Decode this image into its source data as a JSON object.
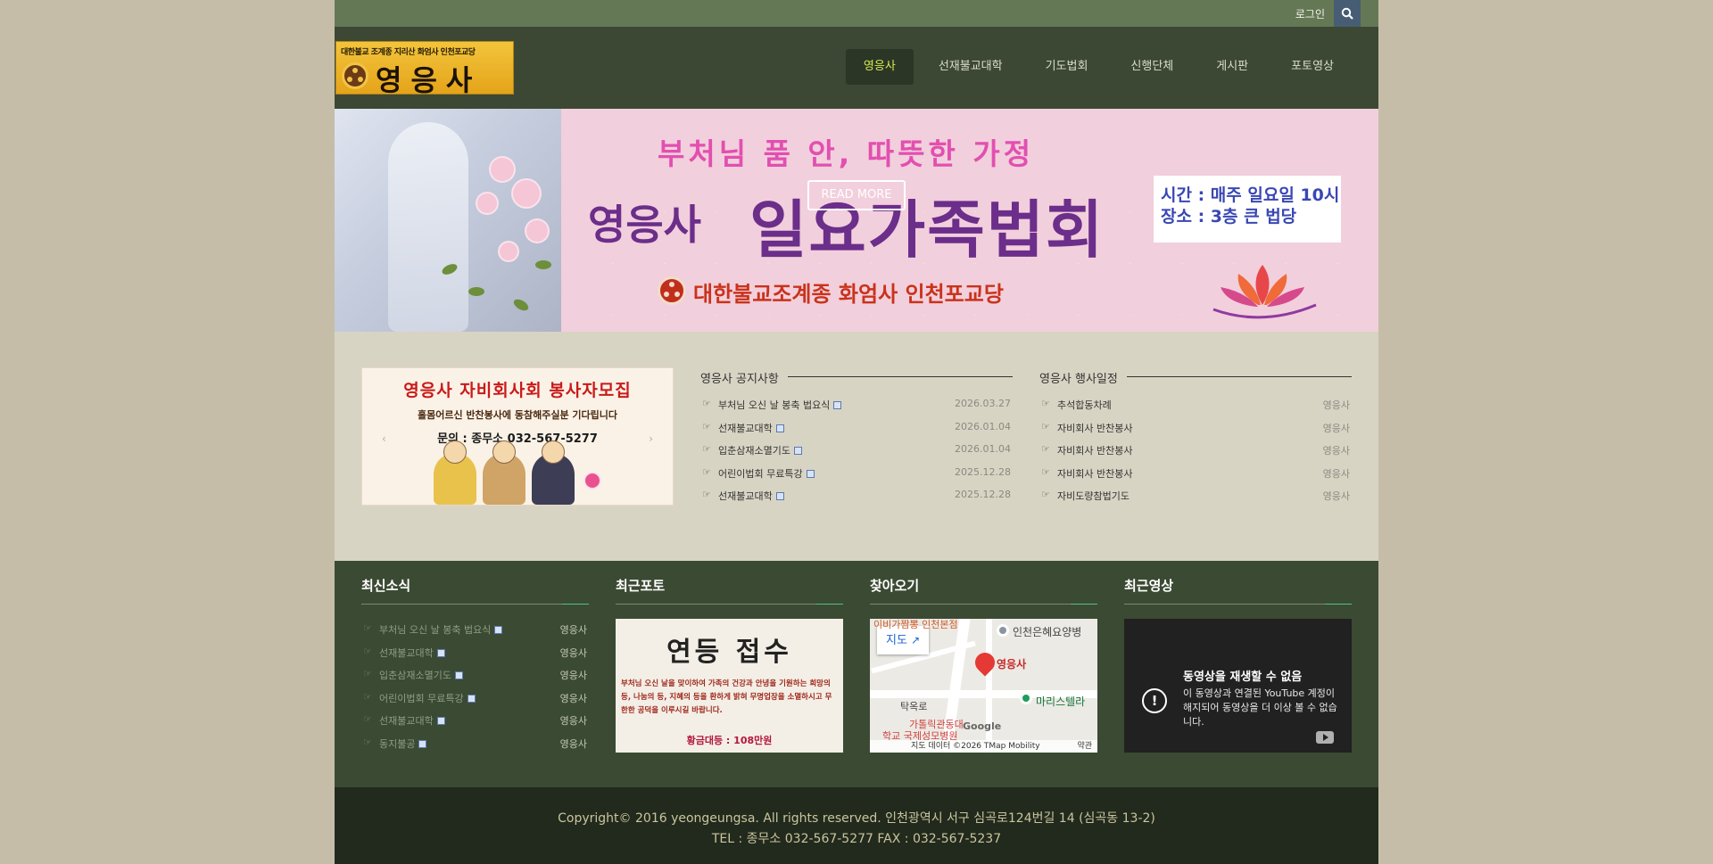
{
  "topbar": {
    "login": "로그인",
    "search_icon": "search-icon"
  },
  "logo": {
    "small_text": "대한불교 조계종 지리산 화엄사 인천포교당",
    "big_text": "영응사"
  },
  "nav": {
    "items": [
      {
        "label": "영응사",
        "active": true
      },
      {
        "label": "선재불교대학",
        "active": false
      },
      {
        "label": "기도법회",
        "active": false
      },
      {
        "label": "신행단체",
        "active": false
      },
      {
        "label": "게시판",
        "active": false
      },
      {
        "label": "포토영상",
        "active": false
      }
    ],
    "active_color": "#d4ea4f"
  },
  "banner": {
    "headline": "부처님 품 안, 따뜻한 가정",
    "title_a": "영응사",
    "title_b": "일요가족법회",
    "read_more": "READ MORE",
    "info_time": "시간 : 매주 일요일 10시",
    "info_place": "장소 : 3층 큰 법당",
    "footer": "대한불교조계종 화엄사 인천포교당"
  },
  "recruit": {
    "title": "영응사 자비회사회 봉사자모집",
    "subtitle": "홀몸어르신 반찬봉사에 동참해주실분 기다립니다",
    "tel": "문의 : 종무소 032-567-5277",
    "prev": "‹",
    "next": "›"
  },
  "notice": {
    "title": "영응사 공지사항",
    "rows": [
      {
        "title": "부처님 오신 날 봉축 법요식",
        "date": "2026.03.27"
      },
      {
        "title": "선재불교대학",
        "date": "2026.01.04"
      },
      {
        "title": "입춘삼재소멸기도",
        "date": "2026.01.04"
      },
      {
        "title": "어린이법회 무료특강",
        "date": "2025.12.28"
      },
      {
        "title": "선재불교대학",
        "date": "2025.12.28"
      }
    ]
  },
  "events": {
    "title": "영응사 행사일정",
    "rows": [
      {
        "title": "추석합동차례",
        "author": "영응사"
      },
      {
        "title": "자비회사 반찬봉사",
        "author": "영응사"
      },
      {
        "title": "자비회사 반찬봉사",
        "author": "영응사"
      },
      {
        "title": "자비회사 반찬봉사",
        "author": "영응사"
      },
      {
        "title": "자비도량참법기도",
        "author": "영응사"
      }
    ]
  },
  "widgets": {
    "news_title": "최신소식",
    "news": [
      {
        "title": "부처님 오신 날 봉축 법요식",
        "author": "영응사"
      },
      {
        "title": "선재불교대학",
        "author": "영응사"
      },
      {
        "title": "입춘삼재소멸기도",
        "author": "영응사"
      },
      {
        "title": "어린이법회 무료특강",
        "author": "영응사"
      },
      {
        "title": "선재불교대학",
        "author": "영응사"
      },
      {
        "title": "동지불공",
        "author": "영응사"
      }
    ],
    "photo_title": "최근포토",
    "photo": {
      "heading": "연등 접수",
      "text": "부처님 오신 날을 맞이하여 가족의 건강과 안녕을 기원하는 희망의 등, 나눔의 등, 지혜의 등을 환하게 밝혀 무명업장을 소멸하시고 무한한 공덕을 이루시길 바랍니다.",
      "price": "황금대등 : 108만원"
    },
    "map_title": "찾아오기",
    "map": {
      "button": "지도",
      "place": "영응사",
      "labels": [
        "인천은혜요양병",
        "마리스텔라",
        "탁옥로",
        "가톨릭관동대",
        "학교 국제성모병원",
        "이비가짬뽕 인천본점"
      ],
      "footer": "지도 데이터 ©2026 TMap Mobility",
      "terms": "약관",
      "google": "Google"
    },
    "video_title": "최근영상",
    "video": {
      "title": "동영상을 재생할 수 없음",
      "message": "이 동영상과 연결된 YouTube 계정이 해지되어 동영상을 더 이상 볼 수 없습니다."
    }
  },
  "footer": {
    "copyright": "Copyright© 2016 yeongeungsa. All rights reserved. 인천광역시 서구 심곡로124번길 14 (심곡동 13-2)",
    "contact": "TEL : 종무소 032-567-5277 FAX : 032-567-5237"
  }
}
